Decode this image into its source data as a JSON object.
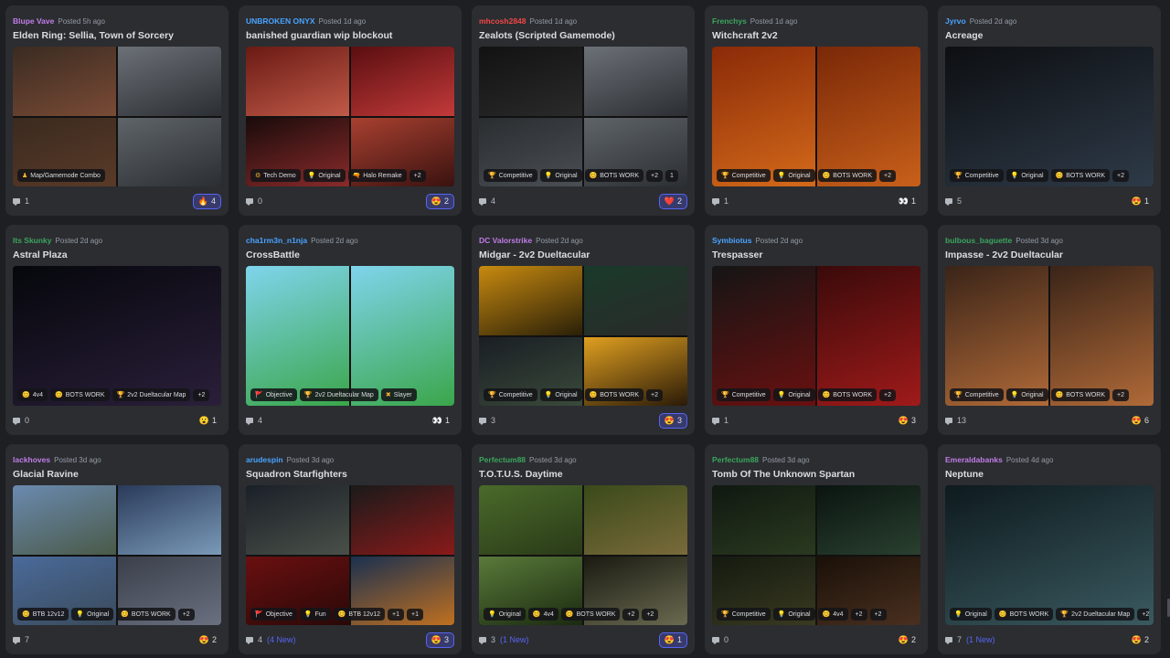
{
  "posts": [
    {
      "author": "Blupe Vave",
      "author_color": "#c27ce8",
      "posted": "Posted 5h ago",
      "title": "Elden Ring: Sellia, Town of Sorcery",
      "layout": "multi",
      "thumbs": [
        [
          "#3a2b22",
          "#7a4b35"
        ],
        [
          "#6c7077",
          "#2b2f33"
        ],
        [
          "#3a2a1f",
          "#5a3a28"
        ],
        [
          "#5f6469",
          "#2b2f33"
        ]
      ],
      "tags": [
        {
          "icon": "♟",
          "text": "Map/Gamemode Combo"
        }
      ],
      "replies": "1",
      "new": "",
      "reaction": {
        "emoji": "🔥",
        "count": "4",
        "active": true
      }
    },
    {
      "author": "UNBROKEN ONYX",
      "author_color": "#4aa3ff",
      "posted": "Posted 1d ago",
      "title": "banished guardian wip blockout",
      "layout": "multi",
      "thumbs": [
        [
          "#6a1a14",
          "#c05a48"
        ],
        [
          "#5a0e10",
          "#c33a3a"
        ],
        [
          "#1a0b0b",
          "#8a2a2a"
        ],
        [
          "#a84030",
          "#3a1210"
        ]
      ],
      "tags": [
        {
          "icon": "⚙",
          "text": "Tech Demo"
        },
        {
          "icon": "💡",
          "text": "Original"
        },
        {
          "icon": "🔫",
          "text": "Halo Remake"
        },
        {
          "icon": "",
          "text": "+2"
        }
      ],
      "replies": "0",
      "new": "",
      "reaction": {
        "emoji": "😍",
        "count": "2",
        "active": true
      }
    },
    {
      "author": "mhcosh2848",
      "author_color": "#f04747",
      "posted": "Posted 1d ago",
      "title": "Zealots (Scripted Gamemode)",
      "layout": "multi",
      "thumbs": [
        [
          "#121212",
          "#2a2a2a"
        ],
        [
          "#6c7077",
          "#2b2f33"
        ],
        [
          "#2a2d30",
          "#4a4f55"
        ],
        [
          "#5f6469",
          "#2b2f33"
        ]
      ],
      "tags": [
        {
          "icon": "🏆",
          "text": "Competitive"
        },
        {
          "icon": "💡",
          "text": "Original"
        },
        {
          "icon": "😊",
          "text": "BOTS WORK"
        },
        {
          "icon": "",
          "text": "+2"
        },
        {
          "icon": "",
          "text": "1"
        }
      ],
      "replies": "4",
      "new": "",
      "reaction": {
        "emoji": "❤️",
        "count": "2",
        "active": true
      }
    },
    {
      "author": "Frenchys",
      "author_color": "#3ba55d",
      "posted": "Posted 1d ago",
      "title": "Witchcraft 2v2",
      "layout": "multi2",
      "thumbs": [
        [
          "#8a2a08",
          "#d46a1a"
        ],
        [
          "#7a2808",
          "#c8601a"
        ]
      ],
      "tags": [
        {
          "icon": "🏆",
          "text": "Competitive"
        },
        {
          "icon": "💡",
          "text": "Original"
        },
        {
          "icon": "😊",
          "text": "BOTS WORK"
        },
        {
          "icon": "",
          "text": "+2"
        }
      ],
      "replies": "1",
      "new": "",
      "reaction": {
        "emoji": "👀",
        "count": "1",
        "active": false
      }
    },
    {
      "author": "Jyrvo",
      "author_color": "#4aa3ff",
      "posted": "Posted 2d ago",
      "title": "Acreage",
      "layout": "single",
      "thumbs": [
        [
          "#0d0f12",
          "#2e3a48"
        ]
      ],
      "tags": [
        {
          "icon": "🏆",
          "text": "Competitive"
        },
        {
          "icon": "💡",
          "text": "Original"
        },
        {
          "icon": "😊",
          "text": "BOTS WORK"
        },
        {
          "icon": "",
          "text": "+2"
        }
      ],
      "replies": "5",
      "new": "",
      "reaction": {
        "emoji": "😍",
        "count": "1",
        "active": false
      }
    },
    {
      "author": "Its Skunky",
      "author_color": "#3ba55d",
      "posted": "Posted 2d ago",
      "title": "Astral Plaza",
      "layout": "single",
      "thumbs": [
        [
          "#06070c",
          "#2a1f3a"
        ]
      ],
      "tags": [
        {
          "icon": "😊",
          "text": "4v4"
        },
        {
          "icon": "😊",
          "text": "BOTS WORK"
        },
        {
          "icon": "🏆",
          "text": "2v2 Dueltacular Map"
        },
        {
          "icon": "",
          "text": "+2"
        }
      ],
      "replies": "0",
      "new": "",
      "reaction": {
        "emoji": "😮",
        "count": "1",
        "active": false
      }
    },
    {
      "author": "cha1rm3n_n1nja",
      "author_color": "#4aa3ff",
      "posted": "Posted 2d ago",
      "title": "CrossBattle",
      "layout": "multi2",
      "thumbs": [
        [
          "#7fd4ec",
          "#3aa64a"
        ],
        [
          "#7fd4ec",
          "#3aa64a"
        ]
      ],
      "tags": [
        {
          "icon": "🚩",
          "text": "Objective"
        },
        {
          "icon": "🏆",
          "text": "2v2 Dueltacular Map"
        },
        {
          "icon": "✖",
          "text": "Slayer"
        }
      ],
      "replies": "4",
      "new": "",
      "reaction": {
        "emoji": "👀",
        "count": "1",
        "active": false
      }
    },
    {
      "author": "DC Valorstrike",
      "author_color": "#c27ce8",
      "posted": "Posted 2d ago",
      "title": "Midgar - 2v2 Dueltacular",
      "layout": "multi",
      "thumbs": [
        [
          "#c88a10",
          "#2a2008"
        ],
        [
          "#1a3a2a",
          "#2a2a2a"
        ],
        [
          "#1a1e24",
          "#3a4a3a"
        ],
        [
          "#e0a020",
          "#2a1a08"
        ]
      ],
      "tags": [
        {
          "icon": "🏆",
          "text": "Competitive"
        },
        {
          "icon": "💡",
          "text": "Original"
        },
        {
          "icon": "😊",
          "text": "BOTS WORK"
        },
        {
          "icon": "",
          "text": "+2"
        }
      ],
      "replies": "3",
      "new": "",
      "reaction": {
        "emoji": "😍",
        "count": "3",
        "active": true
      }
    },
    {
      "author": "Symbiotus",
      "author_color": "#4aa3ff",
      "posted": "Posted 2d ago",
      "title": "Trespasser",
      "layout": "multi2",
      "thumbs": [
        [
          "#151515",
          "#6a1010"
        ],
        [
          "#3a0a0a",
          "#a01a1a"
        ]
      ],
      "tags": [
        {
          "icon": "🏆",
          "text": "Competitive"
        },
        {
          "icon": "💡",
          "text": "Original"
        },
        {
          "icon": "😊",
          "text": "BOTS WORK"
        },
        {
          "icon": "",
          "text": "+2"
        }
      ],
      "replies": "1",
      "new": "",
      "reaction": {
        "emoji": "😍",
        "count": "3",
        "active": false
      }
    },
    {
      "author": "bulbous_baguette",
      "author_color": "#3ba55d",
      "posted": "Posted 3d ago",
      "title": "Impasse - 2v2 Dueltacular",
      "layout": "multi2",
      "thumbs": [
        [
          "#3a2418",
          "#b06a38"
        ],
        [
          "#3a2418",
          "#b06a38"
        ]
      ],
      "tags": [
        {
          "icon": "🏆",
          "text": "Competitive"
        },
        {
          "icon": "💡",
          "text": "Original"
        },
        {
          "icon": "😊",
          "text": "BOTS WORK"
        },
        {
          "icon": "",
          "text": "+2"
        }
      ],
      "replies": "13",
      "new": "",
      "reaction": {
        "emoji": "😍",
        "count": "6",
        "active": false
      }
    },
    {
      "author": "lackhoves",
      "author_color": "#c27ce8",
      "posted": "Posted 3d ago",
      "title": "Glacial Ravine",
      "layout": "multi",
      "thumbs": [
        [
          "#6a8ab0",
          "#4a5a48"
        ],
        [
          "#2a3a5a",
          "#7a9ab8"
        ],
        [
          "#4a6a9a",
          "#3a4a5a"
        ],
        [
          "#3a3f4a",
          "#6a7080"
        ]
      ],
      "tags": [
        {
          "icon": "😊",
          "text": "BTB 12v12"
        },
        {
          "icon": "💡",
          "text": "Original"
        },
        {
          "icon": "😊",
          "text": "BOTS WORK"
        },
        {
          "icon": "",
          "text": "+2"
        }
      ],
      "replies": "7",
      "new": "",
      "reaction": {
        "emoji": "😍",
        "count": "2",
        "active": false
      }
    },
    {
      "author": "arudespin",
      "author_color": "#4aa3ff",
      "posted": "Posted 3d ago",
      "title": "Squadron Starfighters",
      "layout": "multi",
      "thumbs": [
        [
          "#1a2028",
          "#4a5048"
        ],
        [
          "#1a1a1a",
          "#8a1a1a"
        ],
        [
          "#6a1010",
          "#2a0808"
        ],
        [
          "#1a3050",
          "#c07020"
        ]
      ],
      "tags": [
        {
          "icon": "🚩",
          "text": "Objective"
        },
        {
          "icon": "💡",
          "text": "Fun"
        },
        {
          "icon": "😊",
          "text": "BTB 12v12"
        },
        {
          "icon": "",
          "text": "+1"
        },
        {
          "icon": "",
          "text": "+1"
        }
      ],
      "replies": "4",
      "new": "(4 New)",
      "reaction": {
        "emoji": "😍",
        "count": "3",
        "active": true
      }
    },
    {
      "author": "Perfectum88",
      "author_color": "#3ba55d",
      "posted": "Posted 3d ago",
      "title": "T.O.T.U.S. Daytime",
      "layout": "multi",
      "thumbs": [
        [
          "#4a6a2a",
          "#2a3a18"
        ],
        [
          "#3a4a1a",
          "#7a6a3a"
        ],
        [
          "#5a7a3a",
          "#1a2a10"
        ],
        [
          "#1a1a12",
          "#6a6a50"
        ]
      ],
      "tags": [
        {
          "icon": "💡",
          "text": "Original"
        },
        {
          "icon": "😊",
          "text": "4v4"
        },
        {
          "icon": "😊",
          "text": "BOTS WORK"
        },
        {
          "icon": "",
          "text": "+2"
        },
        {
          "icon": "",
          "text": "+2"
        }
      ],
      "replies": "3",
      "new": "(1 New)",
      "reaction": {
        "emoji": "😍",
        "count": "1",
        "active": true
      }
    },
    {
      "author": "Perfectum88",
      "author_color": "#3ba55d",
      "posted": "Posted 3d ago",
      "title": "Tomb Of The Unknown Spartan",
      "layout": "multi",
      "thumbs": [
        [
          "#101810",
          "#2a3a20"
        ],
        [
          "#0a1410",
          "#2a4030"
        ],
        [
          "#141a10",
          "#3a3a20"
        ],
        [
          "#1a1008",
          "#4a3020"
        ]
      ],
      "tags": [
        {
          "icon": "🏆",
          "text": "Competitive"
        },
        {
          "icon": "💡",
          "text": "Original"
        },
        {
          "icon": "😊",
          "text": "4v4"
        },
        {
          "icon": "",
          "text": "+2"
        },
        {
          "icon": "",
          "text": "+2"
        }
      ],
      "replies": "0",
      "new": "",
      "reaction": {
        "emoji": "😍",
        "count": "2",
        "active": false
      }
    },
    {
      "author": "Emeraldabanks",
      "author_color": "#c27ce8",
      "posted": "Posted 4d ago",
      "title": "Neptune",
      "layout": "single",
      "thumbs": [
        [
          "#0e1a1e",
          "#3a5a60"
        ]
      ],
      "tags": [
        {
          "icon": "💡",
          "text": "Original"
        },
        {
          "icon": "😊",
          "text": "BOTS WORK"
        },
        {
          "icon": "🏆",
          "text": "2v2 Dueltacular Map"
        },
        {
          "icon": "",
          "text": "+2"
        }
      ],
      "replies": "7",
      "new": "(1 New)",
      "reaction": {
        "emoji": "😍",
        "count": "2",
        "active": false
      }
    }
  ]
}
